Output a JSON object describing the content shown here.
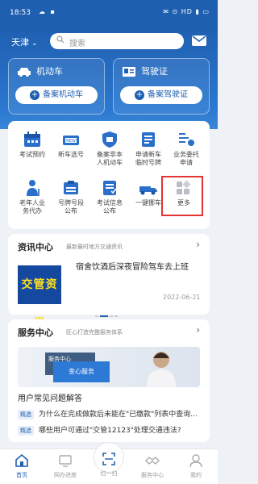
{
  "status_bar": {
    "time": "18:53",
    "left_icons": "☁ ▪",
    "right_icons": "✉ ⊙ HD ▮ ▭"
  },
  "header": {
    "city": "天津",
    "search_placeholder": "搜索"
  },
  "cards": [
    {
      "title": "机动车",
      "button": "备案机动车",
      "icon": "car-icon"
    },
    {
      "title": "驾驶证",
      "button": "备案驾驶证",
      "icon": "license-icon"
    }
  ],
  "grid": [
    {
      "label_1": "考试预约",
      "label_2": "",
      "icon": "calendar-icon"
    },
    {
      "label_1": "新车选号",
      "label_2": "",
      "icon": "new-plate-icon"
    },
    {
      "label_1": "备案非本",
      "label_2": "人机动车",
      "icon": "shield-icon"
    },
    {
      "label_1": "申请新车",
      "label_2": "临时号牌",
      "icon": "temp-plate-icon"
    },
    {
      "label_1": "业务委托",
      "label_2": "申请",
      "icon": "delegate-icon"
    },
    {
      "label_1": "老年人业",
      "label_2": "务代办",
      "icon": "elderly-icon"
    },
    {
      "label_1": "号牌号段",
      "label_2": "公布",
      "icon": "plate-range-icon"
    },
    {
      "label_1": "考试信息",
      "label_2": "公布",
      "icon": "exam-info-icon"
    },
    {
      "label_1": "一键挪车",
      "label_2": "",
      "icon": "tow-truck-icon"
    },
    {
      "label_1": "更多",
      "label_2": "",
      "icon": "more-icon"
    }
  ],
  "news": {
    "title": "资讯中心",
    "subtitle": "最新最时地方交通资讯",
    "thumb_text": "交管资讯",
    "headline": "宿舍饮酒后深夜冒险驾车去上班",
    "date": "2022-06-21"
  },
  "service": {
    "title": "服务中心",
    "subtitle": "匠心打造完整服务体系",
    "banner_box1": "服务中心",
    "banner_box2": "金心服务",
    "qa_title": "用户常见问题解答",
    "faqs": [
      {
        "tag": "精选",
        "text": "为什么在完成做款后未能在\"已缴款\"列表中查询..."
      },
      {
        "tag": "精选",
        "text": "哪些用户可通过\"交管12123\"处理交通违法?"
      }
    ]
  },
  "nav": [
    {
      "label": "首页",
      "icon": "home-icon",
      "active": true
    },
    {
      "label": "网办进度",
      "icon": "monitor-icon",
      "active": false
    },
    {
      "label": "扫一扫",
      "icon": "scan-icon",
      "active": false
    },
    {
      "label": "服务中心",
      "icon": "handshake-icon",
      "active": false
    },
    {
      "label": "我的",
      "icon": "user-icon",
      "active": false
    }
  ],
  "colors": {
    "primary": "#1f5fb0",
    "highlight": "#e23434"
  }
}
